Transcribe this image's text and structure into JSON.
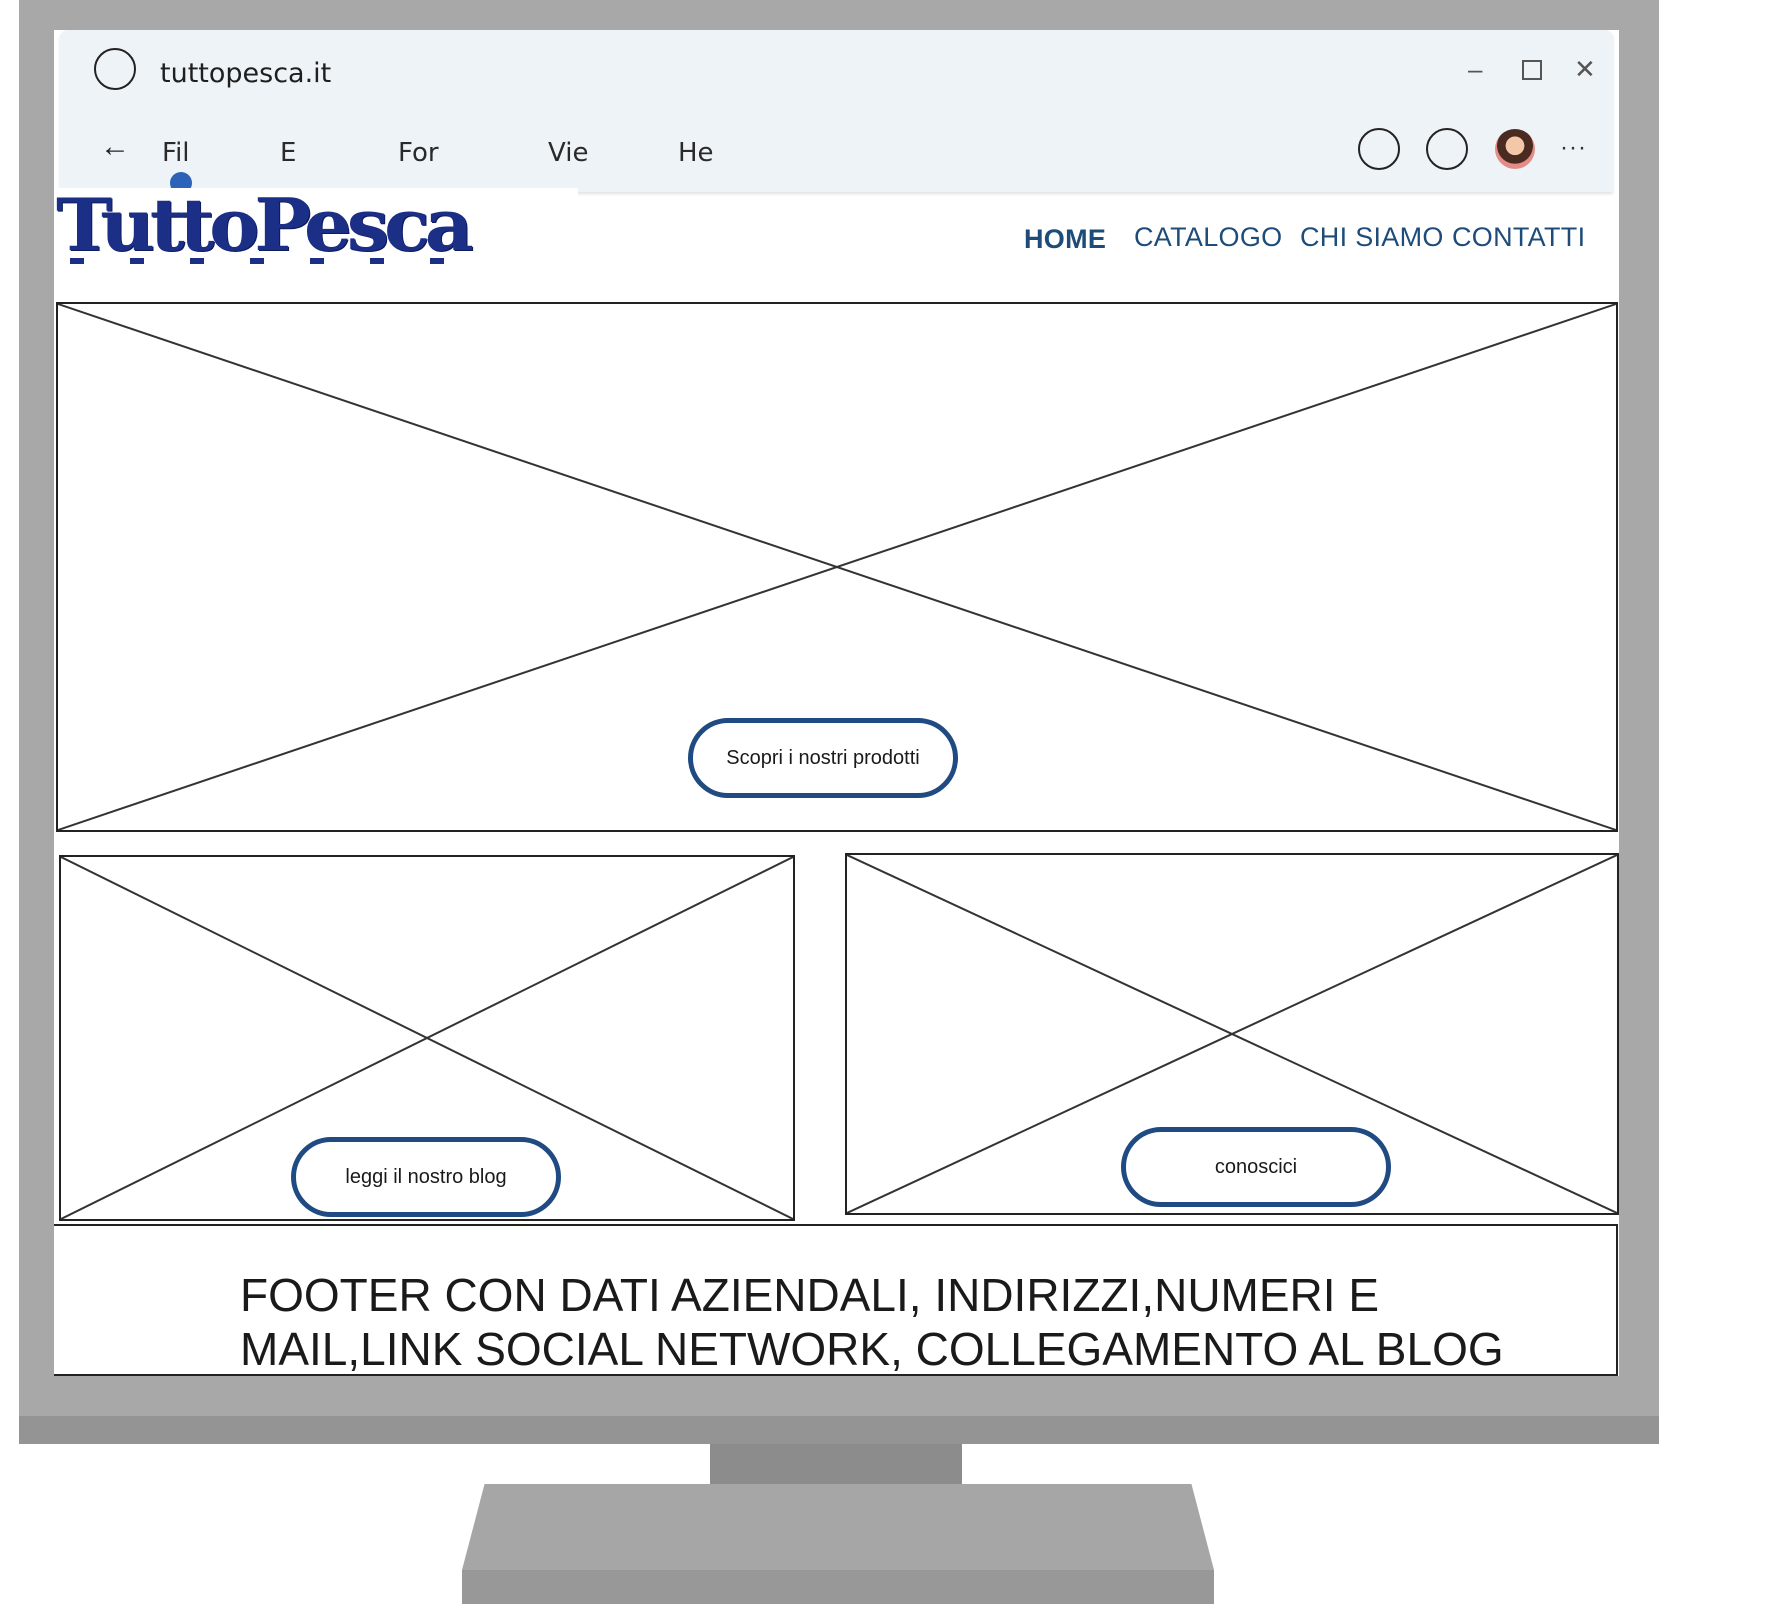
{
  "browser": {
    "title": "tuttopesca.it",
    "menu": [
      "Fil",
      "E",
      "For",
      "Vie",
      "He"
    ],
    "back_icon": "back-arrow-icon",
    "window_controls": [
      "minimize-icon",
      "maximize-icon",
      "close-icon"
    ],
    "more_label": "···"
  },
  "site": {
    "logo_text": "TuttoPesca",
    "nav": [
      "HOME",
      "CATALOGO",
      "CHI SIAMO",
      "CONTATTI"
    ],
    "hero_button": "Scopri i nostri prodotti",
    "blog_button": "leggi il nostro blog",
    "about_button": "conoscici",
    "footer_text": "FOOTER CON DATI AZIENDALI, INDIRIZZI,NUMERI E MAIL,LINK SOCIAL NETWORK, COLLEGAMENTO AL BLOG"
  },
  "colors": {
    "nav": "#1e4c7a",
    "button_border": "#1f4a82",
    "logo": "#1c2f86",
    "monitor": "#a8a8a8"
  }
}
